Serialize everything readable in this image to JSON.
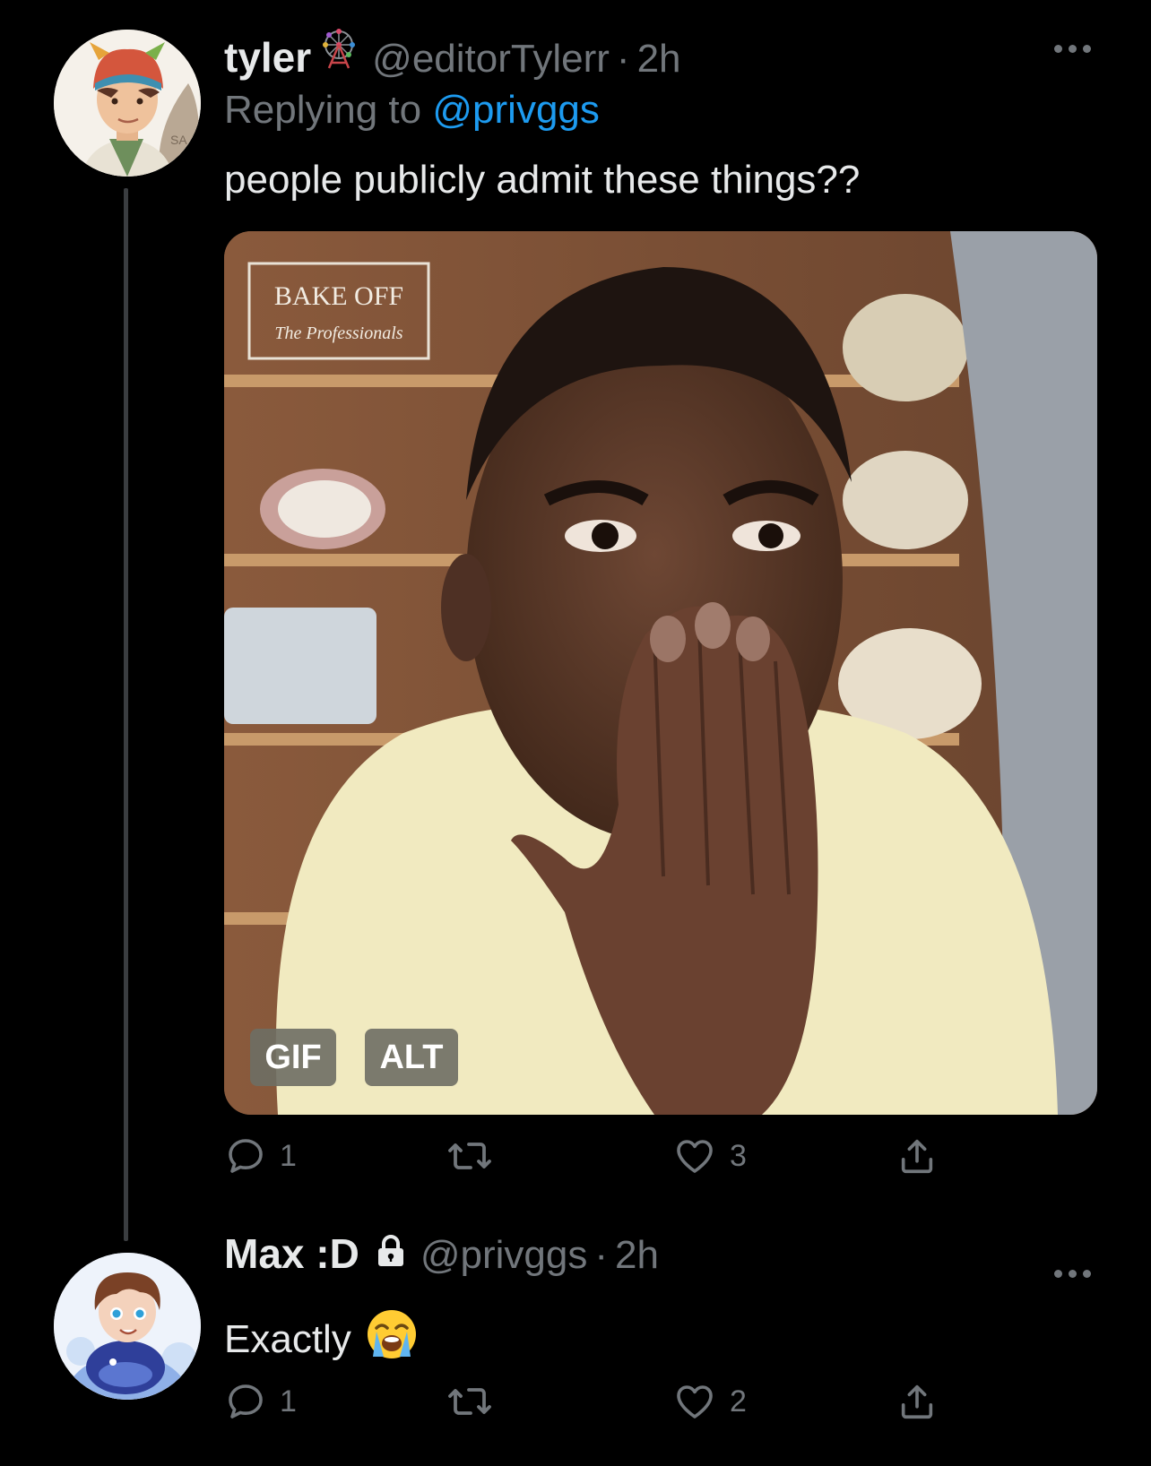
{
  "tweet1": {
    "name": "tyler",
    "handle": "@editorTylerr",
    "separator": "·",
    "time": "2h",
    "replying_prefix": "Replying to",
    "replying_handle": "@privggs",
    "text": "people publicly admit these things??",
    "media": {
      "overlay_logo_line1": "BAKE OFF",
      "overlay_logo_line2": "The Professionals",
      "gif_badge": "GIF",
      "alt_badge": "ALT"
    },
    "actions": {
      "reply_count": "1",
      "retweet_count": "",
      "like_count": "3"
    }
  },
  "tweet2": {
    "name": "Max :D",
    "handle": "@privggs",
    "separator": "·",
    "time": "2h",
    "text": "Exactly",
    "emoji_name": "loudly-crying-face",
    "actions": {
      "reply_count": "1",
      "retweet_count": "",
      "like_count": "2"
    }
  },
  "colors": {
    "background": "#000000",
    "primary_text": "#e7e9ea",
    "secondary_text": "#71767b",
    "link": "#1d9bf0",
    "thread_line": "#3a3d40"
  }
}
